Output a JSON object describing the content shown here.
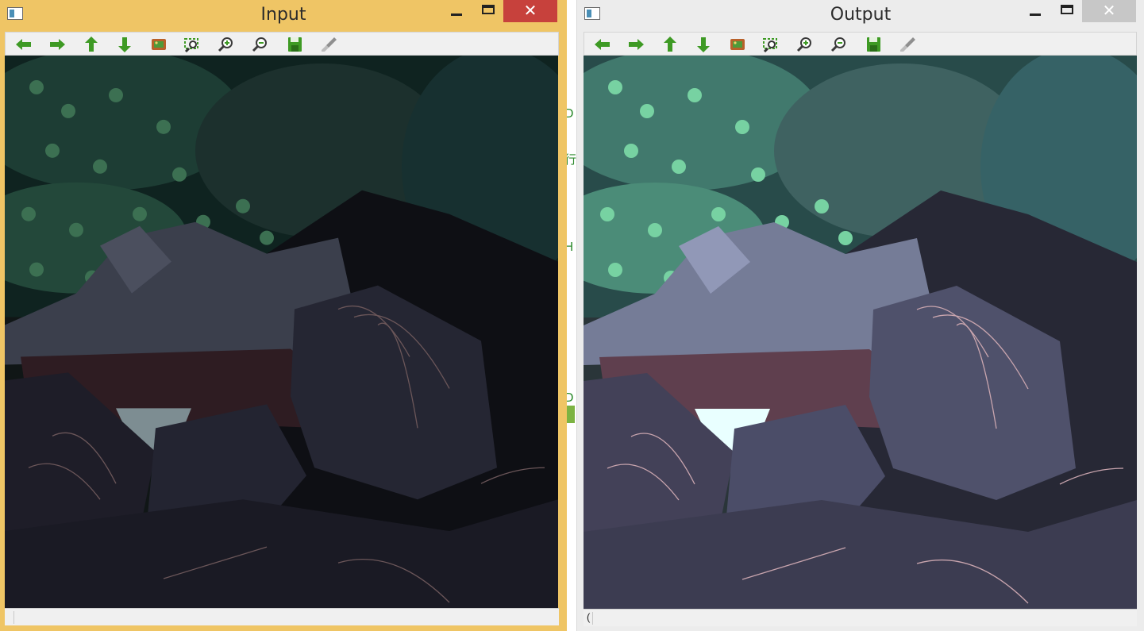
{
  "windows": {
    "input": {
      "title": "Input",
      "status": ""
    },
    "output": {
      "title": "Output",
      "status": "("
    }
  },
  "title_controls": {
    "minimize": "",
    "maximize": "",
    "close": "✕"
  },
  "toolbar": [
    "pan-left-icon",
    "pan-right-icon",
    "pan-up-icon",
    "pan-down-icon",
    "fit-image-icon",
    "zoom-region-icon",
    "zoom-in-icon",
    "zoom-out-icon",
    "save-icon",
    "properties-icon"
  ],
  "background_glyphs": [
    "D",
    "行",
    "H",
    "D"
  ],
  "colors": {
    "active_titlebar": "#efc565",
    "close_active": "#c7413c",
    "close_inactive": "#c7c7c7",
    "arrow_green": "#3e9a24"
  }
}
